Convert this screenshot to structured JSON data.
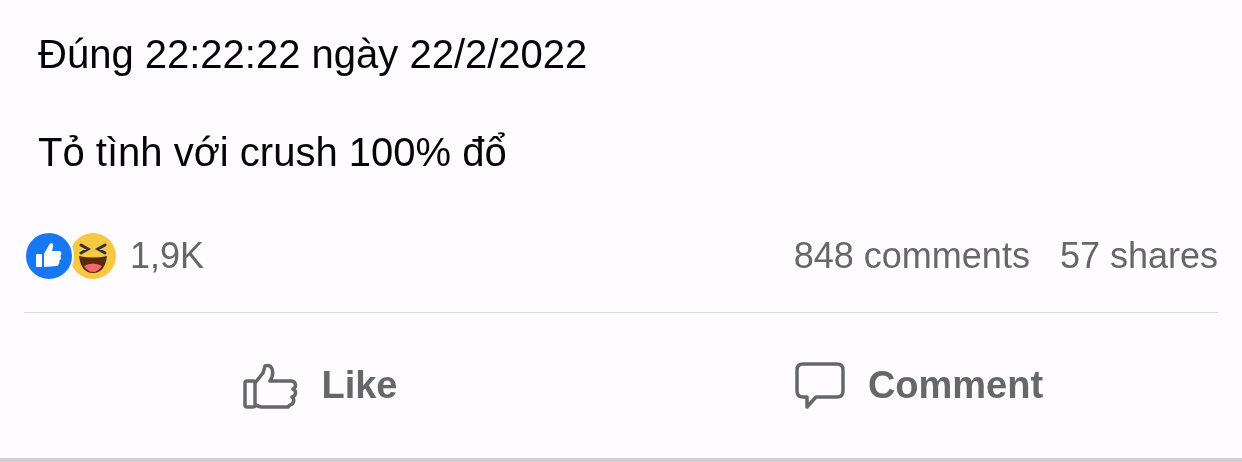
{
  "post": {
    "lines": [
      "Đúng 22:22:22 ngày 22/2/2022",
      "Tỏ tình với crush 100% đổ"
    ]
  },
  "stats": {
    "reaction_count": "1,9K",
    "comments": "848 comments",
    "shares": "57 shares"
  },
  "actions": [
    {
      "kind": "like",
      "label": "Like"
    },
    {
      "kind": "comment",
      "label": "Comment"
    }
  ]
}
